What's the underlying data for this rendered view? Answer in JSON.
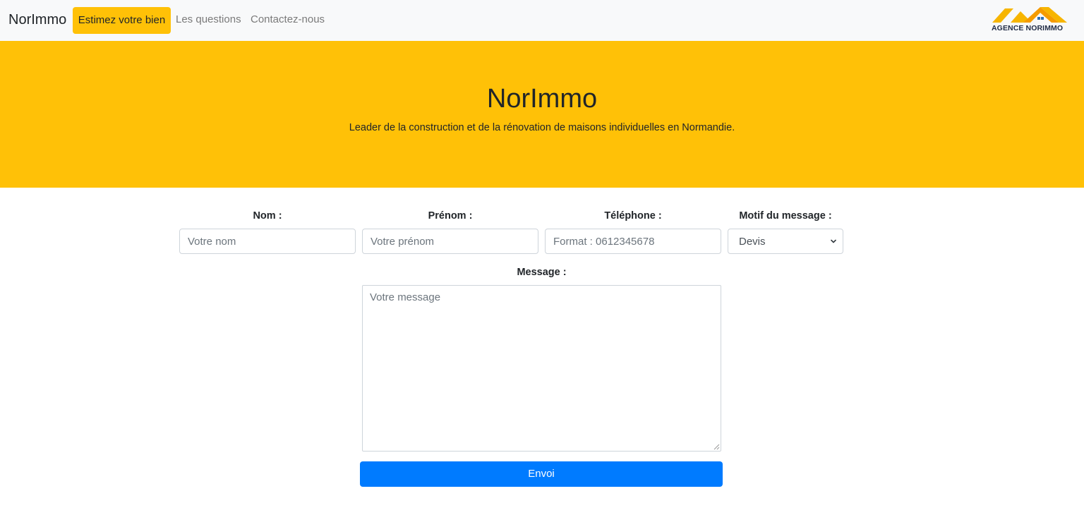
{
  "navbar": {
    "brand": "NorImmo",
    "links": [
      {
        "label": "Estimez votre bien",
        "active": true
      },
      {
        "label": "Les questions",
        "active": false
      },
      {
        "label": "Contactez-nous",
        "active": false
      }
    ],
    "logo_text": "AGENCE NORIMMO"
  },
  "hero": {
    "title": "NorImmo",
    "subtitle": "Leader de la construction et de la rénovation de maisons individuelles en Normandie."
  },
  "form": {
    "nom": {
      "label": "Nom :",
      "placeholder": "Votre nom",
      "value": ""
    },
    "prenom": {
      "label": "Prénom :",
      "placeholder": "Votre prénom",
      "value": ""
    },
    "telephone": {
      "label": "Téléphone :",
      "placeholder": "Format : 0612345678",
      "value": ""
    },
    "motif": {
      "label": "Motif du message :",
      "selected": "Devis"
    },
    "message": {
      "label": "Message :",
      "placeholder": "Votre message",
      "value": ""
    },
    "submit_label": "Envoi"
  },
  "colors": {
    "accent": "#ffc107",
    "primary": "#007bff",
    "navbar_bg": "#f8f9fa"
  }
}
